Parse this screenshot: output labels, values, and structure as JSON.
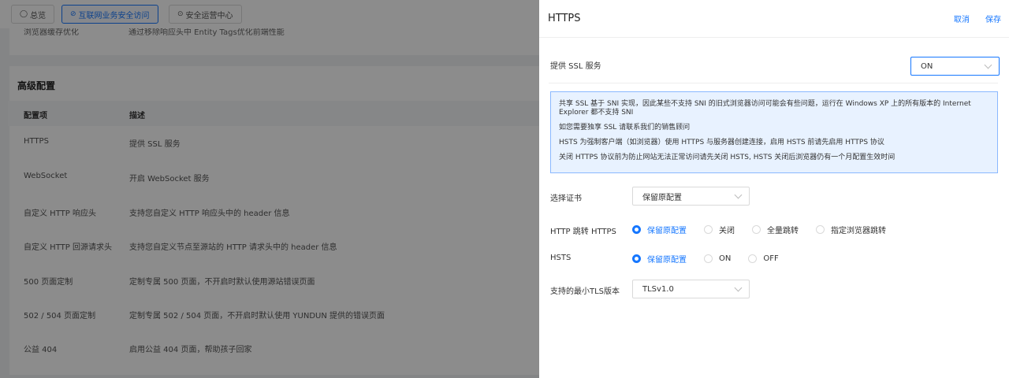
{
  "background": {
    "tabs": [
      {
        "icon": "◯",
        "label": "总览"
      },
      {
        "icon": "⊘",
        "label": "互联网业务安全访问"
      },
      {
        "icon": "⊙",
        "label": "安全运营中心"
      }
    ],
    "prev_row": {
      "name": "浏览器缓存优化",
      "desc": "通过移除响应头中 Entity Tags优化前端性能"
    },
    "section_title": "高级配置",
    "table_headers": [
      "配置项",
      "描述"
    ],
    "rows": [
      {
        "name": "HTTPS",
        "desc": "提供 SSL 服务"
      },
      {
        "name": "WebSocket",
        "desc": "开启 WebSocket 服务"
      },
      {
        "name": "自定义 HTTP 响应头",
        "desc": "支持您自定义 HTTP 响应头中的 header 信息"
      },
      {
        "name": "自定义 HTTP 回源请求头",
        "desc": "支持您自定义节点至源站的 HTTP 请求头中的 header 信息"
      },
      {
        "name": "500 页面定制",
        "desc": "定制专属 500 页面，不开启时默认使用源站错误页面"
      },
      {
        "name": "502 / 504 页面定制",
        "desc": "定制专属 502 / 504 页面，不开启时默认使用 YUNDUN 提供的错误页面"
      },
      {
        "name": "公益 404",
        "desc": "启用公益 404 页面，帮助孩子回家"
      }
    ]
  },
  "drawer": {
    "title": "HTTPS",
    "cancel": "取消",
    "save": "保存",
    "ssl_label": "提供 SSL 服务",
    "ssl_value": "ON",
    "info": [
      "共享 SSL 基于 SNI 实现，因此某些不支持 SNI 的旧式浏览器访问可能会有些问题，运行在 Windows XP 上的所有版本的 Internet Explorer 都不支持 SNI",
      "如您需要独享 SSL 请联系我们的销售顾问",
      "HSTS 为强制客户端（如浏览器）使用 HTTPS 与服务器创建连接，启用 HSTS 前请先启用 HTTPS 协议",
      "关闭 HTTPS 协议前为防止网站无法正常访问请先关闭 HSTS, HSTS 关闭后浏览器仍有一个月配置生效时间"
    ],
    "cert_label": "选择证书",
    "cert_value": "保留原配置",
    "redirect_label": "HTTP 跳转 HTTPS",
    "redirect_options": [
      "保留原配置",
      "关闭",
      "全量跳转",
      "指定浏览器跳转"
    ],
    "hsts_label": "HSTS",
    "hsts_options": [
      "保留原配置",
      "ON",
      "OFF"
    ],
    "tls_label": "支持的最小TLS版本",
    "tls_value": "TLSv1.0",
    "accent_color": "#1677ff"
  }
}
